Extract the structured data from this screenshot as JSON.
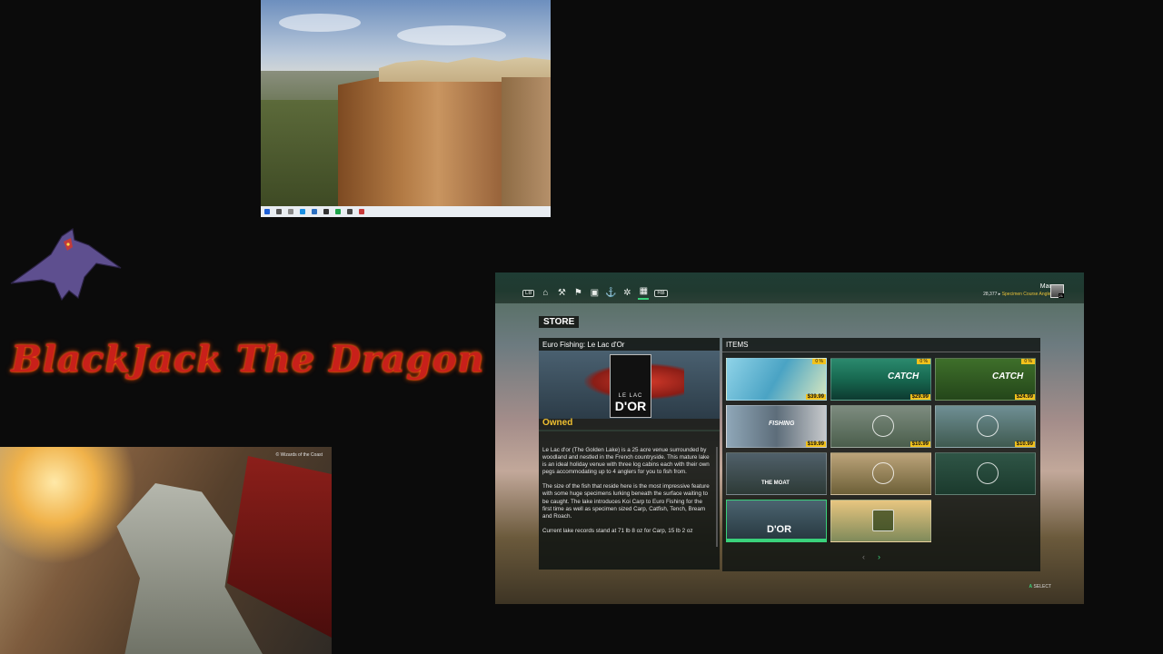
{
  "brand": {
    "title": "BlackJack The Dragon"
  },
  "dragon_art": {
    "credit": "© Wizards of the Coast"
  },
  "game": {
    "nav": {
      "lb": "LB",
      "rb": "RB",
      "icons": [
        "home-icon",
        "tackle-icon",
        "map-icon",
        "shop-bag-icon",
        "boat-icon",
        "settings-icon",
        "store-basket-icon"
      ],
      "active": "store-basket-icon"
    },
    "user": {
      "name": "Mac",
      "xp": "28,377",
      "rank": "Specimen Course Angler",
      "level": "21"
    },
    "store_label": "STORE",
    "detail": {
      "title": "Euro Fishing: Le Lac d'Or",
      "logo_line1": "LE LAC",
      "logo_line2": "D'OR",
      "status": "Owned",
      "para1": "Le Lac d'or (The Golden Lake) is a 25 acre venue surrounded by woodland and nestled in the French countryside. This mature lake is an ideal holiday venue with three log cabins each with their own pegs accommodating up to 4 anglers for you to fish from.",
      "para2": "The size of the fish that reside here is the most impressive feature with some huge specimens lurking beneath the surface waiting to be caught. The lake introduces Koi Carp to Euro Fishing for the first time as well as specimen sized Carp, Catfish, Tench, Bream and Roach.",
      "para3": "Current lake records stand at 71 lb 8 oz for Carp, 15 lb 2 oz"
    },
    "items_label": "ITEMS",
    "items": [
      {
        "price": "$39.99",
        "discount": "0 %",
        "text": ""
      },
      {
        "price": "$29.99",
        "discount": "0 %",
        "text": "CATCH"
      },
      {
        "price": "$24.99",
        "discount": "0 %",
        "text": "CATCH"
      },
      {
        "price": "$19.99",
        "discount": "",
        "text": "FISHING"
      },
      {
        "price": "$10.99",
        "discount": "",
        "text": ""
      },
      {
        "price": "$10.99",
        "discount": "",
        "text": ""
      },
      {
        "price": "",
        "discount": "",
        "text": "THE MOAT"
      },
      {
        "price": "",
        "discount": "",
        "text": ""
      },
      {
        "price": "",
        "discount": "",
        "text": ""
      },
      {
        "price": "",
        "discount": "",
        "text": "D'OR"
      },
      {
        "price": "",
        "discount": "",
        "text": ""
      }
    ],
    "pager": {
      "prev": "‹",
      "next": "›"
    },
    "footer": {
      "button": "A",
      "label": "SELECT"
    }
  }
}
